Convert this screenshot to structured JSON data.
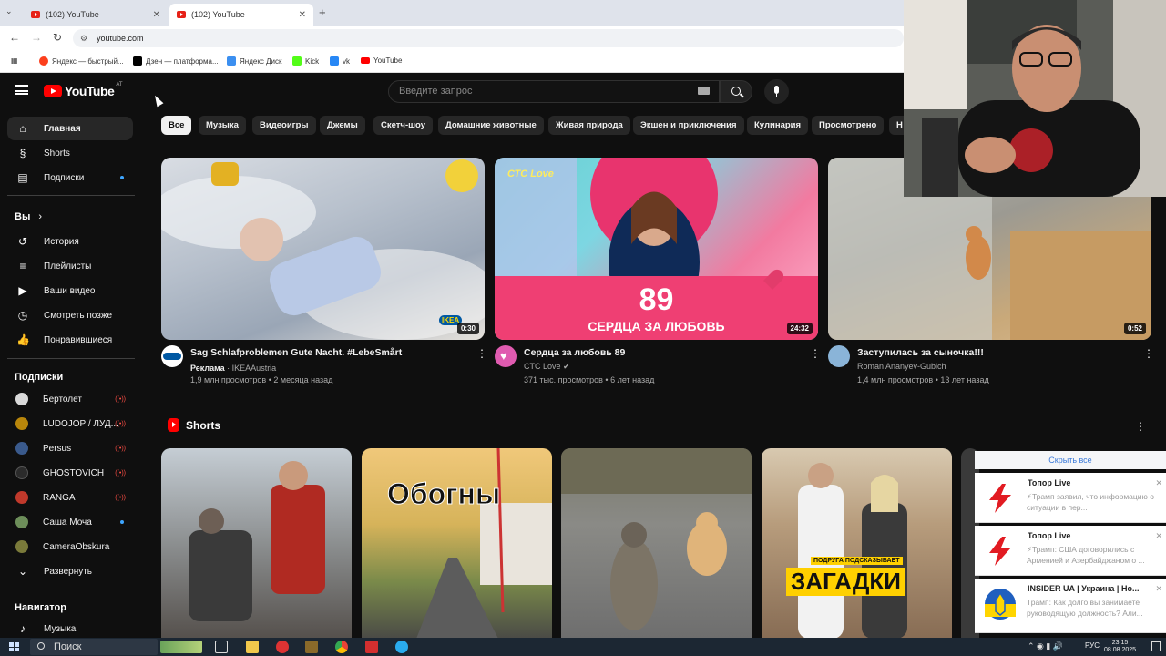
{
  "browser": {
    "tabs": [
      {
        "title": "(102) YouTube",
        "active": false
      },
      {
        "title": "(102) YouTube",
        "active": true
      }
    ],
    "url": "youtube.com",
    "bookmarks": [
      {
        "label": "Яндекс — быстрый...",
        "color": "#fc3f1d"
      },
      {
        "label": "Дзен — платформа...",
        "color": "#000000"
      },
      {
        "label": "Яндекс Диск",
        "color": "#3b8ff0"
      },
      {
        "label": "Kick",
        "color": "#53fc18"
      },
      {
        "label": "vk",
        "color": "#2787f5"
      },
      {
        "label": "YouTube",
        "color": "#ff0000"
      }
    ]
  },
  "youtube": {
    "logo_text": "YouTube",
    "country": "AT",
    "search_placeholder": "Введите запрос",
    "sidebar": {
      "main": [
        {
          "label": "Главная",
          "icon": "home-icon",
          "active": true
        },
        {
          "label": "Shorts",
          "icon": "shorts-icon"
        },
        {
          "label": "Подписки",
          "icon": "subscriptions-icon",
          "dot": true
        }
      ],
      "you_header": "Вы",
      "you": [
        {
          "label": "История",
          "icon": "history-icon"
        },
        {
          "label": "Плейлисты",
          "icon": "playlists-icon"
        },
        {
          "label": "Ваши видео",
          "icon": "your-videos-icon"
        },
        {
          "label": "Смотреть позже",
          "icon": "watch-later-icon"
        },
        {
          "label": "Понравившиеся",
          "icon": "liked-icon"
        }
      ],
      "subs_header": "Подписки",
      "subs": [
        {
          "label": "Бертолет",
          "live": true,
          "color": "#d9d9d9"
        },
        {
          "label": "LUDOJOP / ЛУД...",
          "live": true,
          "color": "#b8860b"
        },
        {
          "label": "Persus",
          "live": true,
          "color": "#3a5a8c"
        },
        {
          "label": "GHOSTOVICH",
          "live": true,
          "color": "#2b2b2b"
        },
        {
          "label": "RANGA",
          "live": true,
          "color": "#c0392b"
        },
        {
          "label": "Саша Мочa",
          "dot": true,
          "color": "#6d8e5a"
        },
        {
          "label": "CameraObskura",
          "color": "#7a7a3a"
        }
      ],
      "expand": "Развернуть",
      "nav_header": "Навигатор",
      "nav": [
        {
          "label": "Музыка",
          "icon": "music-icon"
        }
      ]
    },
    "chips": [
      "Все",
      "Музыка",
      "Видеоигры",
      "Джемы",
      "Скетч-шоу",
      "Домашние животные",
      "Живая природа",
      "Экшен и приключения",
      "Кулинария",
      "Просмотрено",
      "Н"
    ],
    "videos": [
      {
        "title": "Sag Schlafproblemen Gute Nacht. #LebeSmårt",
        "ad_label": "Реклама",
        "channel": "IKEAAustria",
        "views": "1,9 млн просмотров",
        "age": "2 месяца назад",
        "duration": "0:30",
        "thumb_brand": "IKEA"
      },
      {
        "title": "Сердца за любовь 89",
        "channel": "CTC Love",
        "verified": "✔",
        "views": "371 тыс. просмотров",
        "age": "6 лет назад",
        "duration": "24:32",
        "thumb_number": "89",
        "thumb_caption": "СЕРДЦА ЗА ЛЮБОВЬ",
        "thumb_logo": "СТС Love"
      },
      {
        "title": "Заступилась за сыночка!!!",
        "channel": "Roman Ananyev-Gubich",
        "views": "1,4 млн просмотров",
        "age": "13 лет назад",
        "duration": "0:52"
      }
    ],
    "shorts_title": "Shorts",
    "shorts": [
      {
        "overlay": ""
      },
      {
        "overlay": "Обогны"
      },
      {
        "overlay": ""
      },
      {
        "overlay": "ЗАГАДКИ",
        "subcaption": "ПОДРУГА ПОДСКАЗЫВАЕТ"
      }
    ]
  },
  "notifications": {
    "hide_all": "Скрыть все",
    "items": [
      {
        "source": "Топор Live",
        "message": "⚡Трамп заявил, что информацию о ситуации в пер..."
      },
      {
        "source": "Топор Live",
        "message": "⚡Трамп: США договорились с Арменией и Азербайджаном о ..."
      },
      {
        "source": "INSIDER UA | Украина | Но...",
        "message": "Трамп: Как долго вы занимаете руководящую должность? Али..."
      }
    ]
  },
  "taskbar": {
    "search_label": "Поиск",
    "lang": "РУС",
    "time": "23:15",
    "date": "08.08.2025"
  }
}
